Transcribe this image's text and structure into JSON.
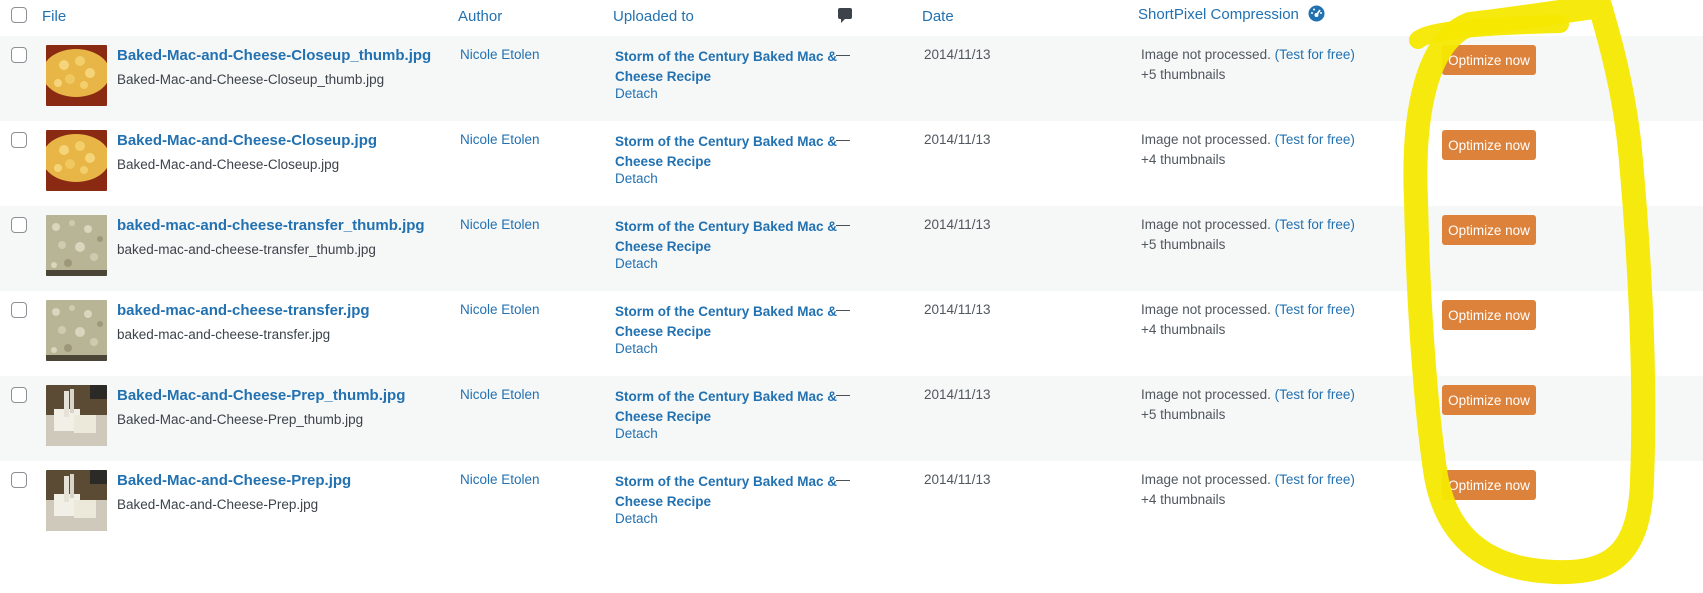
{
  "header": {
    "file_label": "File",
    "author_label": "Author",
    "uploaded_label": "Uploaded to",
    "comments_icon": "comment-bubble-icon",
    "date_label": "Date",
    "compression_label": "ShortPixel Compression",
    "compression_icon": "gauge-icon"
  },
  "rows": [
    {
      "title": "Baked-Mac-and-Cheese-Closeup_thumb.jpg",
      "filename": "Baked-Mac-and-Cheese-Closeup_thumb.jpg",
      "author": "Nicole Etolen",
      "uploaded_line1": "Storm of the Century Baked Mac &",
      "uploaded_line2": "Cheese Recipe",
      "detach": "Detach",
      "comments": "—",
      "date": "2014/11/13",
      "status": "Image not processed.",
      "test_link": "(Test for free)",
      "thumbnails": "+5 thumbnails",
      "button": "Optimize now"
    },
    {
      "title": "Baked-Mac-and-Cheese-Closeup.jpg",
      "filename": "Baked-Mac-and-Cheese-Closeup.jpg",
      "author": "Nicole Etolen",
      "uploaded_line1": "Storm of the Century Baked Mac &",
      "uploaded_line2": "Cheese Recipe",
      "detach": "Detach",
      "comments": "—",
      "date": "2014/11/13",
      "status": "Image not processed.",
      "test_link": "(Test for free)",
      "thumbnails": "+4 thumbnails",
      "button": "Optimize now"
    },
    {
      "title": "baked-mac-and-cheese-transfer_thumb.jpg",
      "filename": "baked-mac-and-cheese-transfer_thumb.jpg",
      "author": "Nicole Etolen",
      "uploaded_line1": "Storm of the Century Baked Mac &",
      "uploaded_line2": "Cheese Recipe",
      "detach": "Detach",
      "comments": "—",
      "date": "2014/11/13",
      "status": "Image not processed.",
      "test_link": "(Test for free)",
      "thumbnails": "+5 thumbnails",
      "button": "Optimize now"
    },
    {
      "title": "baked-mac-and-cheese-transfer.jpg",
      "filename": "baked-mac-and-cheese-transfer.jpg",
      "author": "Nicole Etolen",
      "uploaded_line1": "Storm of the Century Baked Mac &",
      "uploaded_line2": "Cheese Recipe",
      "detach": "Detach",
      "comments": "—",
      "date": "2014/11/13",
      "status": "Image not processed.",
      "test_link": "(Test for free)",
      "thumbnails": "+4 thumbnails",
      "button": "Optimize now"
    },
    {
      "title": "Baked-Mac-and-Cheese-Prep_thumb.jpg",
      "filename": "Baked-Mac-and-Cheese-Prep_thumb.jpg",
      "author": "Nicole Etolen",
      "uploaded_line1": "Storm of the Century Baked Mac &",
      "uploaded_line2": "Cheese Recipe",
      "detach": "Detach",
      "comments": "—",
      "date": "2014/11/13",
      "status": "Image not processed.",
      "test_link": "(Test for free)",
      "thumbnails": "+5 thumbnails",
      "button": "Optimize now"
    },
    {
      "title": "Baked-Mac-and-Cheese-Prep.jpg",
      "filename": "Baked-Mac-and-Cheese-Prep.jpg",
      "author": "Nicole Etolen",
      "uploaded_line1": "Storm of the Century Baked Mac &",
      "uploaded_line2": "Cheese Recipe",
      "detach": "Detach",
      "comments": "—",
      "date": "2014/11/13",
      "status": "Image not processed.",
      "test_link": "(Test for free)",
      "thumbnails": "+4 thumbnails",
      "button": "Optimize now"
    }
  ],
  "colors": {
    "link": "#2271b1",
    "button": "#dd823b",
    "row_alt": "#f6f7f7",
    "highlight": "#f5e800"
  }
}
